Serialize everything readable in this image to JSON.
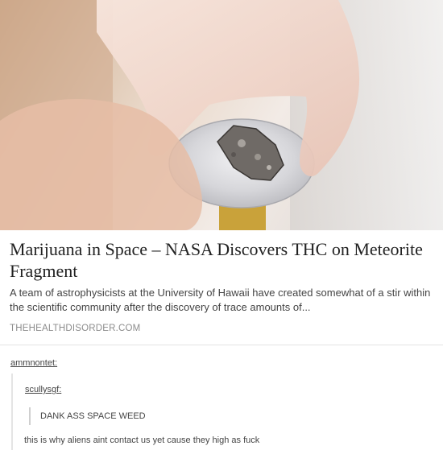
{
  "link_card": {
    "title": "Marijuana in Space – NASA Discovers THC on Meteorite Fragment",
    "description": "A team of astrophysicists at the University of Hawaii have created somewhat of a stir within the scientific community after the discovery of trace amounts of...",
    "source": "THEHEALTHDISORDER.COM"
  },
  "thread": {
    "user1": "ammnontet",
    "user2": "scullysgf",
    "quote": "DANK ASS SPACE WEED",
    "comment": "this is why aliens aint contact us yet cause they high as fuck"
  },
  "colors": {
    "glove": "#f2d8cd",
    "meteorite": "#6f6a66",
    "plate": "#cfcfd2"
  }
}
